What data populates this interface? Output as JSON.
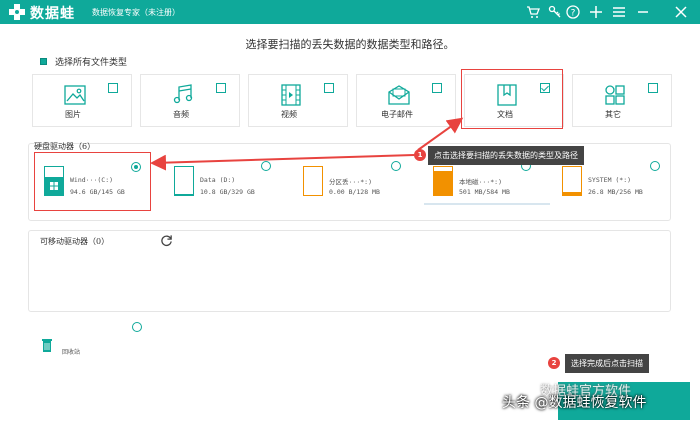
{
  "app": {
    "logo_text": "数据蛙",
    "subtitle": "数据恢复专家（未注册）"
  },
  "main_title": "选择要扫描的丢失数据的数据类型和路径。",
  "select_all_label": "选择所有文件类型",
  "file_types": [
    {
      "label": "图片",
      "checked": false
    },
    {
      "label": "音频",
      "checked": false
    },
    {
      "label": "视频",
      "checked": false
    },
    {
      "label": "电子邮件",
      "checked": false
    },
    {
      "label": "文档",
      "checked": true
    },
    {
      "label": "其它",
      "checked": false
    }
  ],
  "hard_drives": {
    "label": "硬盘驱动器（6）",
    "drives": [
      {
        "name": "Wind···(C:)",
        "size": "94.6 GB/145 GB",
        "selected": true,
        "fill_color": "#0fa99a",
        "fill_pct": 65
      },
      {
        "name": "Data (D:)",
        "size": "10.8 GB/329 GB",
        "selected": false,
        "fill_color": "#0fa99a",
        "fill_pct": 3
      },
      {
        "name": "分区丢···*:)",
        "size": "0.00  B/128 MB",
        "selected": false,
        "fill_color": "#f29100",
        "fill_pct": 0
      },
      {
        "name": "本地磁···*:)",
        "size": "501 MB/584 MB",
        "selected": false,
        "fill_color": "#f29100",
        "fill_pct": 86
      },
      {
        "name": "SYSTEM (*:)",
        "size": "26.8 MB/256 MB",
        "selected": false,
        "fill_color": "#f29100",
        "fill_pct": 10
      }
    ]
  },
  "removable": {
    "label": "可移动驱动器（0）"
  },
  "recycle_label": "回收站",
  "callouts": [
    {
      "num": "1",
      "text": "点击选择要扫描的丢失数据的类型及路径"
    },
    {
      "num": "2",
      "text": "选择完成后点击扫描"
    }
  ],
  "watermark": "头条 @数据蛙恢复软件",
  "watermark_faint": "数据蛙官方软件",
  "colors": {
    "accent": "#0fa99a",
    "highlight": "#e8433f",
    "orange": "#f29100"
  }
}
